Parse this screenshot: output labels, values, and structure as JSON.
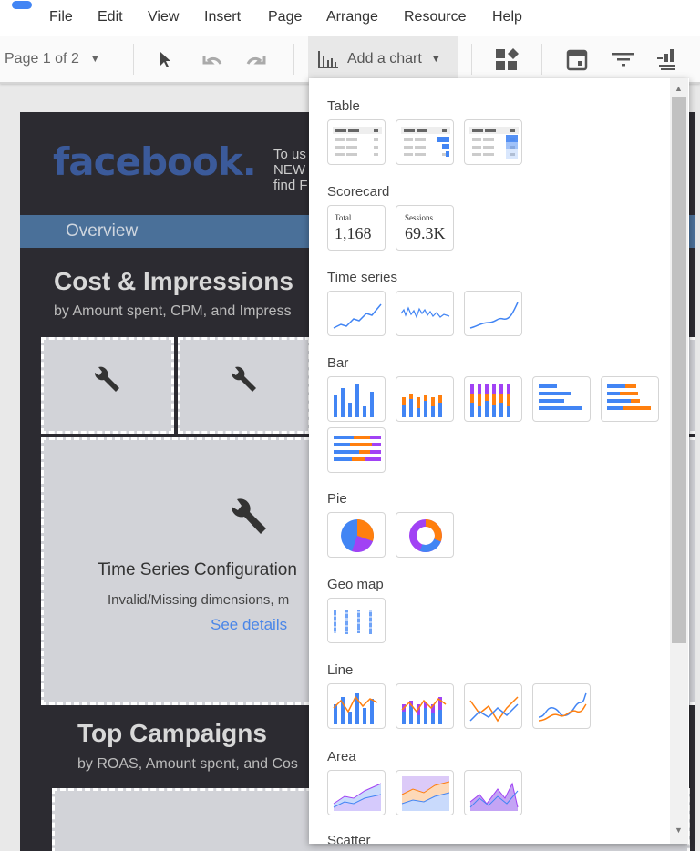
{
  "menu": {
    "items": [
      "File",
      "Edit",
      "View",
      "Insert",
      "Page",
      "Arrange",
      "Resource",
      "Help"
    ]
  },
  "toolbar": {
    "page_selector": "Page 1 of 2",
    "add_chart": "Add a chart"
  },
  "report": {
    "logo": "facebook.",
    "intro_lines": [
      "To us",
      "NEW",
      "find F"
    ],
    "tab": "Overview",
    "section1_title": "Cost & Impressions",
    "section1_subtitle": "by Amount spent, CPM, and Impress",
    "error_title": "Time Series Configuration",
    "error_message": "Invalid/Missing dimensions, m",
    "error_link": "See details",
    "section2_title": "Top Campaigns",
    "section2_subtitle": "by ROAS, Amount spent, and Cos"
  },
  "chart_menu": {
    "sections": [
      {
        "label": "Table",
        "icons": [
          "table",
          "table-bars",
          "table-heatmap"
        ]
      },
      {
        "label": "Scorecard",
        "icons": [
          "scorecard-total",
          "scorecard-sessions"
        ]
      },
      {
        "label": "Time series",
        "icons": [
          "time-series",
          "sparkline",
          "smoothed-time-series"
        ]
      },
      {
        "label": "Bar",
        "icons": [
          "column",
          "stacked-column",
          "100-stacked-column",
          "bar",
          "stacked-bar",
          "100-stacked-bar"
        ]
      },
      {
        "label": "Pie",
        "icons": [
          "pie",
          "donut"
        ]
      },
      {
        "label": "Geo map",
        "icons": [
          "geo-map"
        ]
      },
      {
        "label": "Line",
        "icons": [
          "combo",
          "stacked-combo",
          "line",
          "smoothed-line"
        ]
      },
      {
        "label": "Area",
        "icons": [
          "area",
          "stacked-area",
          "100-stacked-area"
        ]
      },
      {
        "label": "Scatter",
        "icons": []
      }
    ],
    "scorecards": {
      "total_label": "Total",
      "total_value": "1,168",
      "sessions_label": "Sessions",
      "sessions_value": "69.3K"
    }
  },
  "colors": {
    "blue": "#4285f4",
    "orange": "#ff7f0e",
    "purple": "#a142f4",
    "facebook": "#3b5a9a",
    "band": "#4a7099"
  }
}
